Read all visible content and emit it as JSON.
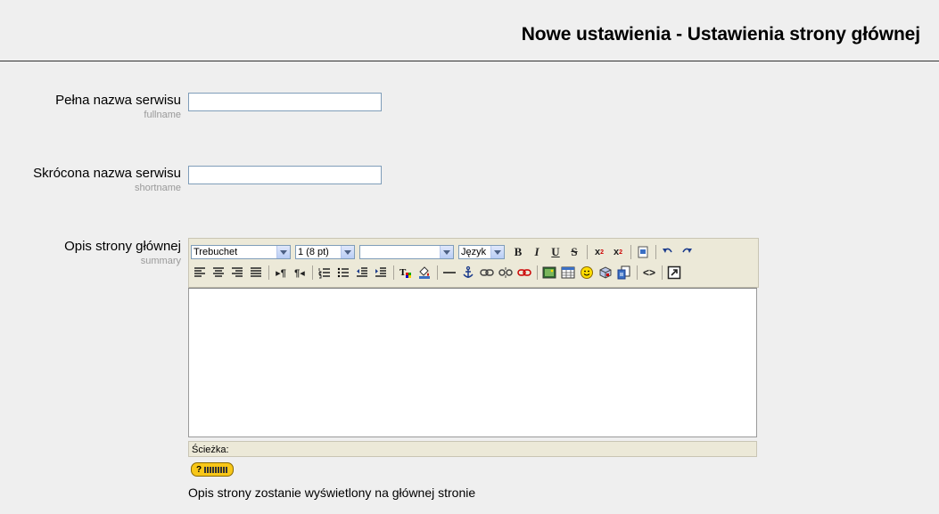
{
  "page": {
    "title": "Nowe ustawienia - Ustawienia strony głównej"
  },
  "fields": {
    "fullname": {
      "label": "Pełna nazwa serwisu",
      "key": "fullname",
      "value": ""
    },
    "shortname": {
      "label": "Skrócona nazwa serwisu",
      "key": "shortname",
      "value": ""
    },
    "summary": {
      "label": "Opis strony głównej",
      "key": "summary"
    }
  },
  "editor": {
    "font_family": "Trebuchet",
    "font_size": "1 (8 pt)",
    "format": "",
    "language": "Język",
    "path_label": "Ścieżka:"
  },
  "description": "Opis strony zostanie wyświetlony na głównej stronie",
  "colors": {
    "background": "#efefef",
    "toolbar": "#ece9d8",
    "help_badge": "#f8c718"
  }
}
